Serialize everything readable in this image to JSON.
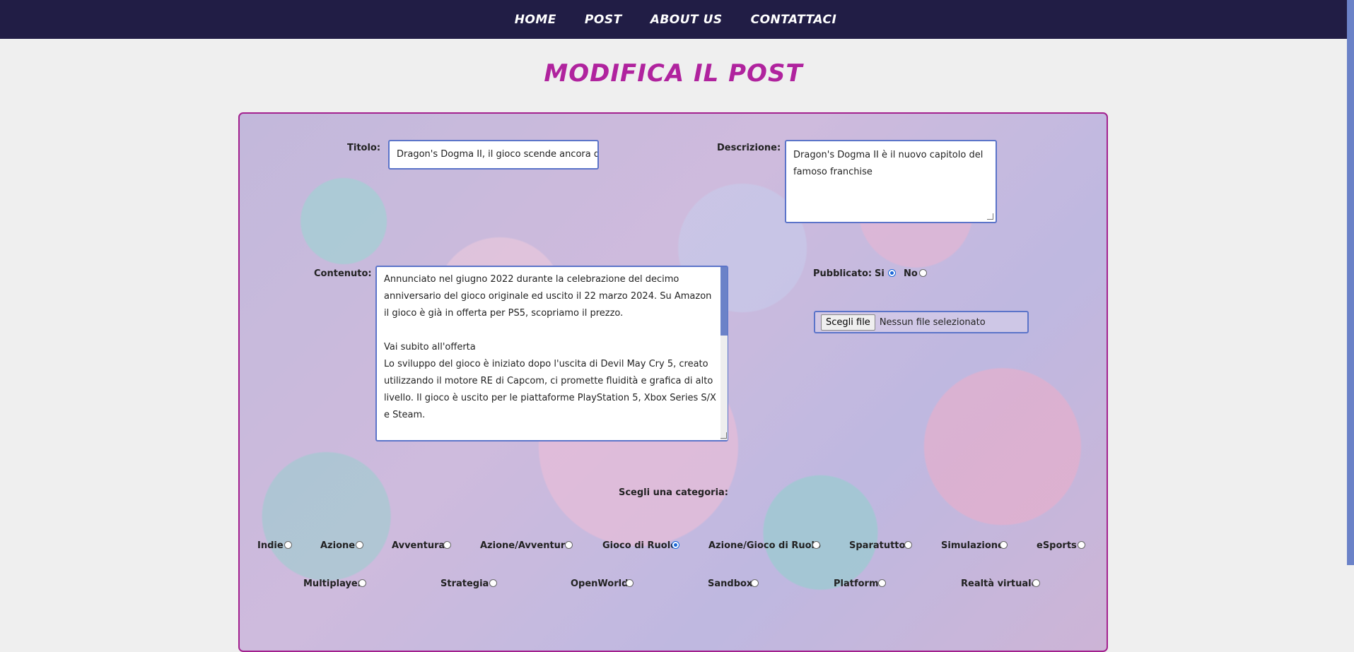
{
  "nav": {
    "items": [
      "HOME",
      "POST",
      "ABOUT US",
      "CONTATTACI"
    ]
  },
  "page": {
    "title": "MODIFICA IL POST"
  },
  "form": {
    "titolo_label": "Titolo:",
    "titolo_value": "Dragon's Dogma II, il gioco scende ancora d",
    "descrizione_label": "Descrizione:",
    "descrizione_value": "Dragon's Dogma II è il nuovo capitolo del famoso franchise",
    "contenuto_label": "Contenuto:",
    "contenuto_paragraphs": [
      "Annunciato nel giugno 2022 durante la celebrazione del decimo anniversario del gioco originale ed uscito il 22 marzo 2024. Su Amazon il gioco è già in offerta per PS5, scopriamo il prezzo.",
      "",
      "Vai subito all'offerta",
      "Lo sviluppo del gioco è iniziato dopo l'uscita di Devil May Cry 5, creato utilizzando il motore RE di Capcom, ci promette fluidità e grafica di alto livello. Il gioco è uscito per le piattaforme PlayStation 5, Xbox Series S/X e Steam."
    ],
    "pubblicato_label": "Pubblicato:",
    "si_label": "Si",
    "no_label": "No",
    "pubblicato_selected": "Si",
    "file_button_label": "Scegli file",
    "file_status": "Nessun file selezionato",
    "categoria_title": "Scegli una categoria:",
    "categories_row1": [
      "Indie",
      "Azione",
      "Avventura",
      "Azione/Avventura",
      "Gioco di Ruolo",
      "Azione/Gioco di Ruolo",
      "Sparatutto",
      "Simulazione",
      "eSports"
    ],
    "categories_row2": [
      "Multiplayer",
      "Strategia",
      "OpenWorld",
      "Sandbox",
      "Platform",
      "Realtà virtuale"
    ],
    "selected_category": "Gioco di Ruolo"
  },
  "colors": {
    "nav_bg": "#211d45",
    "title": "#b0239e",
    "panel_border": "#a3218f",
    "input_border": "#5b74c9",
    "radio_checked": "#1a66d8"
  }
}
